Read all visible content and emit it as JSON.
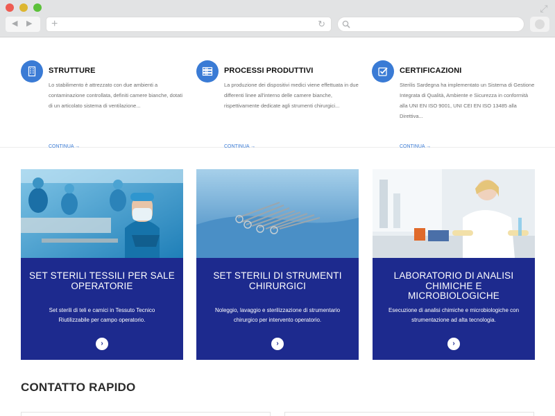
{
  "features": [
    {
      "icon": "building-icon",
      "title": "STRUTTURE",
      "text": "Lo stabilimento è attrezzato con due ambienti a contaminazione controllata, definiti camere bianche, dotati di un articolato sistema di ventilazione...",
      "link": "CONTINUA →"
    },
    {
      "icon": "server-icon",
      "title": "PROCESSI PRODUTTIVI",
      "text": "La produzione dei dispositivi medici viene effettuata in due differenti linee all'interno delle camere bianche, rispettivamente dedicate agli strumenti chirurgici...",
      "link": "CONTINUA →"
    },
    {
      "icon": "checkbox-icon",
      "title": "CERTIFICAZIONI",
      "text": "Sterilis Sardegna ha implementato un Sistema di Gestione Integrata di Qualità, Ambiente e Sicurezza in conformità alla UNI EN ISO 9001, UNI CEI EN ISO 13485 alla Direttiva...",
      "link": "CONTINUA →"
    }
  ],
  "cards": [
    {
      "title": "SET STERILI TESSILI PER SALE OPERATORIE",
      "text": "Set sterili di teli e camici in Tessuto Tecnico Riutilizzabile per campo operatorio.",
      "button": "›"
    },
    {
      "title": "SET STERILI DI STRUMENTI CHIRURGICI",
      "text": "Noleggio, lavaggio e sterilizzazione di strumentario chirurgico per intervento operatorio.",
      "button": "›"
    },
    {
      "title": "LABORATORIO DI ANALISI CHIMICHE E MICROBIOLOGICHE",
      "text": "Esecuzione di analisi chimiche e microbiologiche con strumentazione ad alta tecnologia.",
      "button": "›"
    }
  ],
  "contatto": {
    "title": "CONTATTO RAPIDO"
  },
  "chrome": {
    "back": "◀",
    "forward": "▶",
    "plus": "+",
    "reload": "↻",
    "expand": "⤢"
  },
  "colors": {
    "accent": "#3a7bd5",
    "card_bg": "#1d2a8e"
  }
}
